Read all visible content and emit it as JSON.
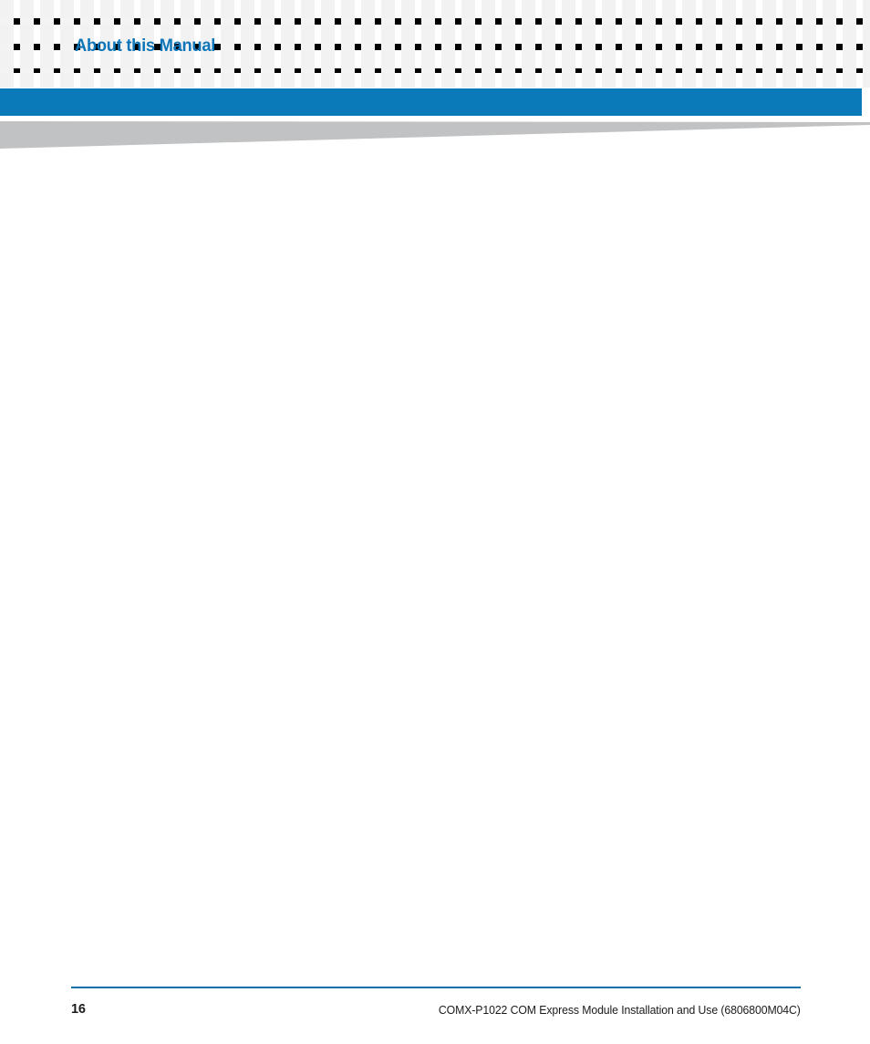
{
  "document": {
    "page_number": "16",
    "footer_title": "COMX-P1022 COM Express Module Installation and Use (6806800M04C)"
  },
  "header": {
    "title": "About this Manual"
  },
  "body": {
    "content": ""
  },
  "colors": {
    "header_title_blue": "#0d75b8",
    "rule_bar_blue": "#0b7ab8",
    "footer_rule_blue": "#0b6fad",
    "wedge_gray": "#c0c2c4",
    "checker_square": "#f2f2f2",
    "text_black": "#1a1a1a",
    "page_background": "#ffffff"
  }
}
